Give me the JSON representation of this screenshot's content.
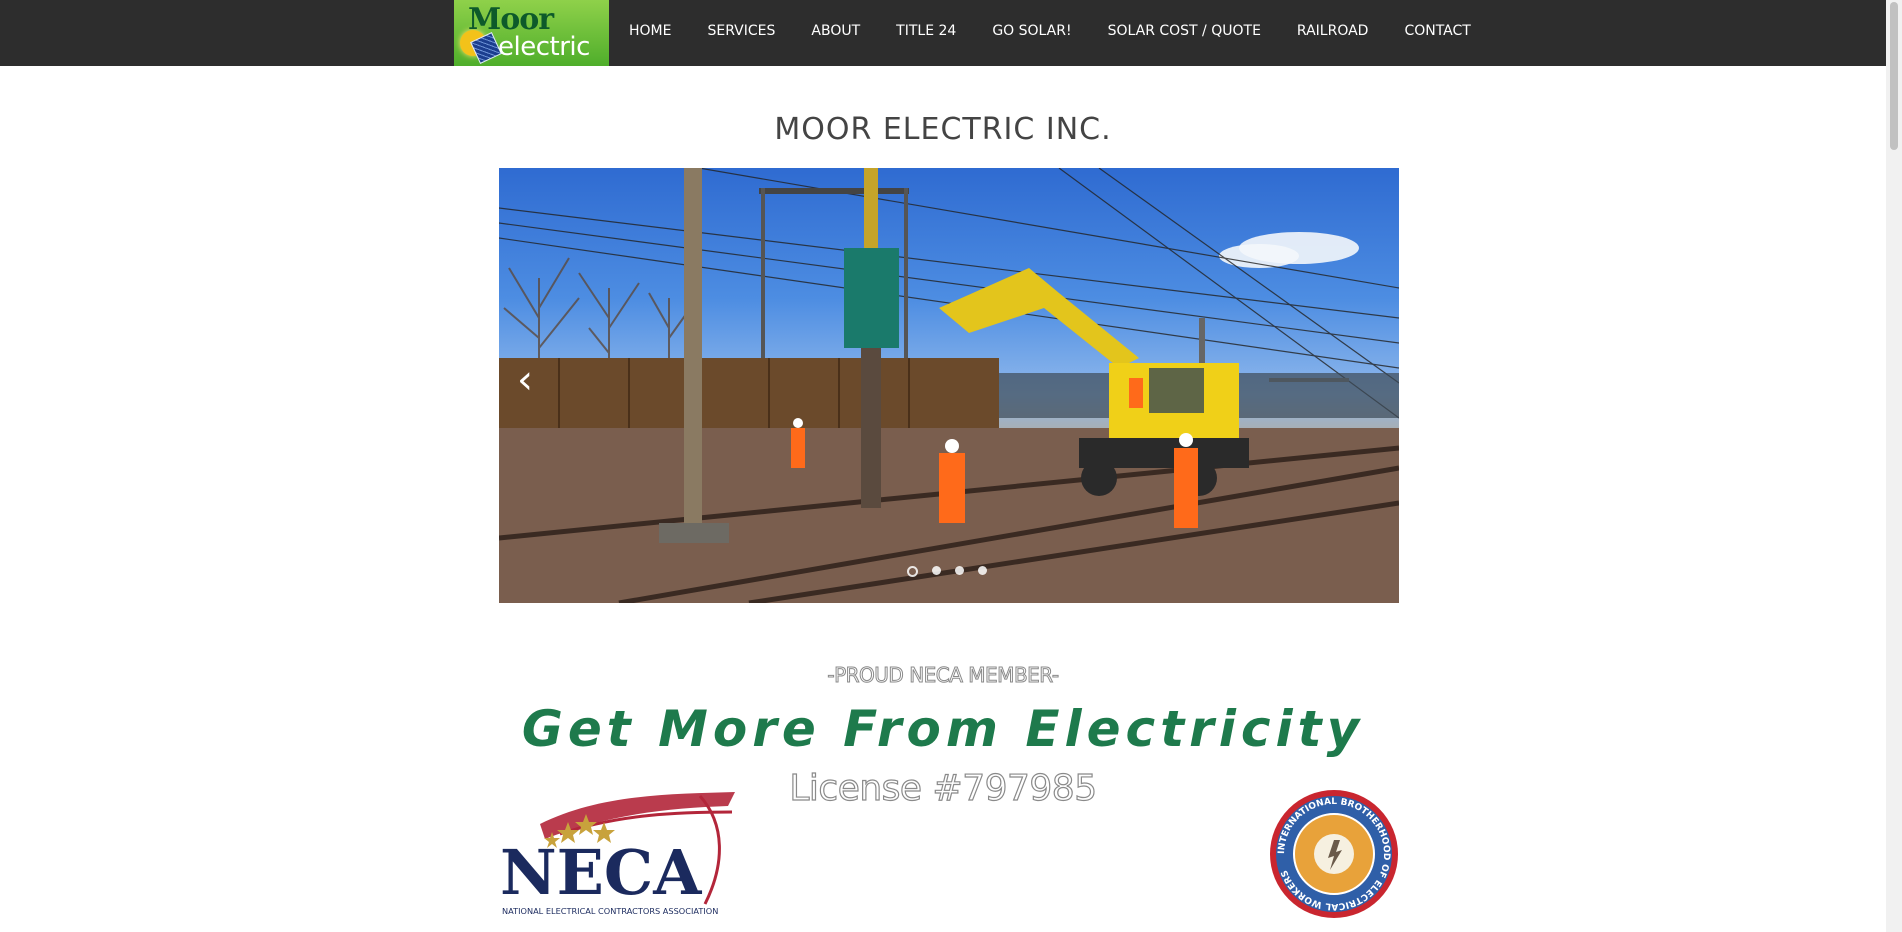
{
  "nav": {
    "logo_text_top": "Moor",
    "logo_text_bottom": "electric",
    "items": [
      {
        "label": "HOME"
      },
      {
        "label": "SERVICES"
      },
      {
        "label": "ABOUT"
      },
      {
        "label": "TITLE 24"
      },
      {
        "label": "GO SOLAR!"
      },
      {
        "label": "SOLAR COST / QUOTE"
      },
      {
        "label": "RAILROAD"
      },
      {
        "label": "CONTACT"
      }
    ]
  },
  "page": {
    "title": "MOOR ELECTRIC INC."
  },
  "slideshow": {
    "prev_arrow": "‹",
    "slide_count": 4,
    "active_index": 0
  },
  "tagline": {
    "member": "-PROUD NECA MEMBER-",
    "slogan": "Get More From Electricity",
    "license": "License #797985"
  },
  "logos": {
    "neca_word": "NECA",
    "neca_sub": "NATIONAL ELECTRICAL CONTRACTORS ASSOCIATION",
    "ibew_ring": "INTERNATIONAL BROTHERHOOD OF ELECTRICAL WORKERS"
  },
  "colors": {
    "nav_bg": "#2d2d2d",
    "slogan_green": "#1e7a4c",
    "neca_navy": "#1b2a5e",
    "neca_red": "#b3263a"
  }
}
